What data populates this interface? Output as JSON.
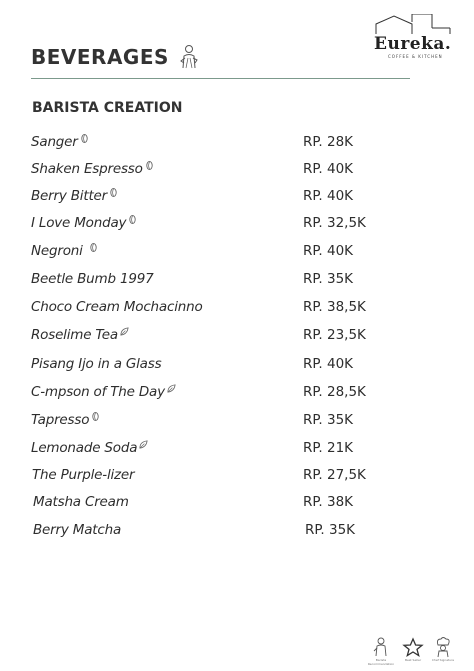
{
  "brand": {
    "name": "Eureka.",
    "tagline": "COFFEE & KITCHEN"
  },
  "page": {
    "title": "BEVERAGES"
  },
  "section": {
    "title": "BARISTA CREATION"
  },
  "items": [
    {
      "name": "Sanger",
      "price": "RP. 28K",
      "icon": "coffee-bean-icon"
    },
    {
      "name": "Shaken Espresso",
      "price": "RP. 40K",
      "icon": "coffee-bean-icon"
    },
    {
      "name": "Berry Bitter",
      "price": "RP. 40K",
      "icon": "coffee-bean-icon"
    },
    {
      "name": "I Love Monday",
      "price": "RP. 32,5K",
      "icon": "coffee-bean-icon"
    },
    {
      "name": "Negroni",
      "price": "RP. 40K",
      "icon": "coffee-bean-icon"
    },
    {
      "name": "Beetle Bumb 1997",
      "price": "RP. 35K",
      "icon": ""
    },
    {
      "name": "Choco Cream Mochacinno",
      "price": "RP. 38,5K",
      "icon": ""
    },
    {
      "name": "Roselime Tea",
      "price": "RP. 23,5K",
      "icon": "leaf-icon"
    },
    {
      "name": "Pisang Ijo in a Glass",
      "price": "RP. 40K",
      "icon": ""
    },
    {
      "name": "C-mpson of The Day",
      "price": "RP. 28,5K",
      "icon": "leaf-icon"
    },
    {
      "name": "Tapresso",
      "price": "RP. 35K",
      "icon": "coffee-bean-icon"
    },
    {
      "name": "Lemonade Soda",
      "price": "RP. 21K",
      "icon": "leaf-icon"
    },
    {
      "name": "The Purple-lizer",
      "price": "RP. 27,5K",
      "icon": ""
    },
    {
      "name": "Matsha Cream",
      "price": "RP. 38K",
      "icon": ""
    },
    {
      "name": "Berry Matcha",
      "price": "RP. 35K",
      "icon": ""
    }
  ],
  "footer": {
    "legend": [
      {
        "label": "Barista Recommendation",
        "icon": "barista-icon"
      },
      {
        "label": "Best Seller",
        "icon": "star-icon"
      },
      {
        "label": "Chef Signature",
        "icon": "chef-icon"
      }
    ]
  }
}
